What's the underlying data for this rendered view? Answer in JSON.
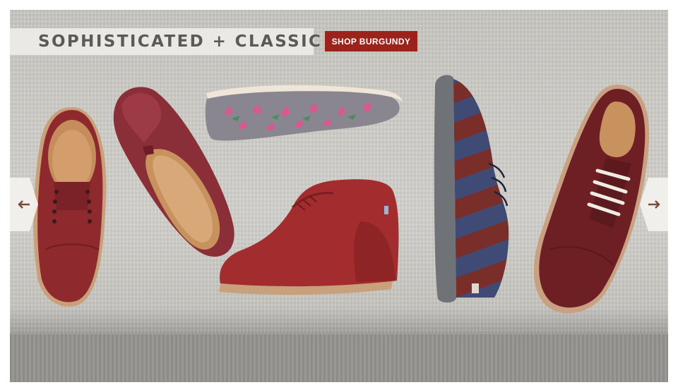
{
  "banner": {
    "headline": "SOPHISTICATED + CLASSIC",
    "cta_label": "SHOP BURGUNDY",
    "accent_color": "#9b231c"
  },
  "carousel": {
    "prev_icon": "arrow-left-icon",
    "next_icon": "arrow-right-icon"
  },
  "products": [
    {
      "id": "burgundy-canvas-laceless-shoe",
      "color": "#8e2a2e"
    },
    {
      "id": "burgundy-metallic-slip-on",
      "color": "#8a2e38"
    },
    {
      "id": "floral-print-slip-on",
      "color": "#8a8690"
    },
    {
      "id": "burgundy-suede-wedge-bootie",
      "color": "#a32c2e"
    },
    {
      "id": "striped-navy-burgundy-sneaker",
      "color": "#3f4a75"
    },
    {
      "id": "burgundy-suede-oxford",
      "color": "#6e1f24"
    }
  ]
}
